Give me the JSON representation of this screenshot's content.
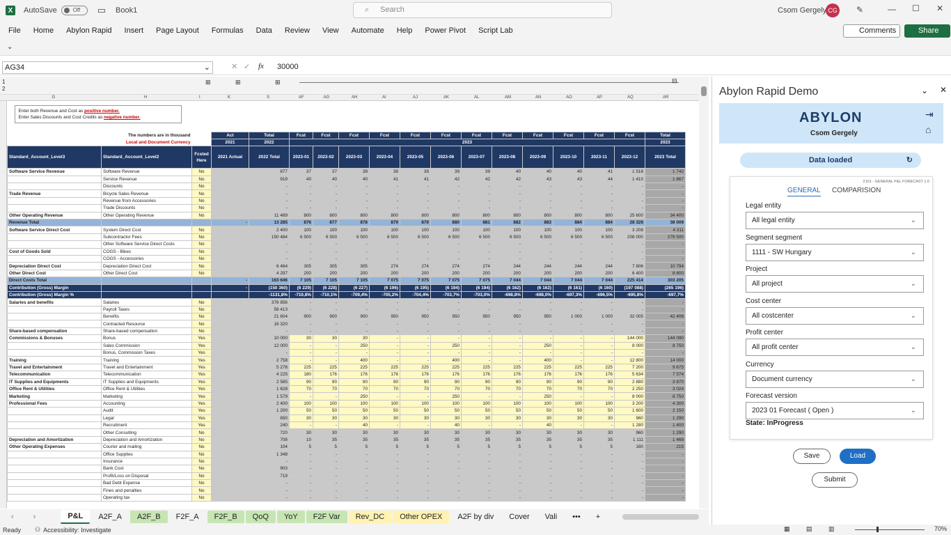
{
  "title_bar": {
    "autosave": "AutoSave",
    "toggle": "Off",
    "book": "Book1",
    "search": "Search",
    "user": "Csom Gergely",
    "initials": "CG"
  },
  "menu": [
    "File",
    "Home",
    "Abylon Rapid",
    "Insert",
    "Page Layout",
    "Formulas",
    "Data",
    "Review",
    "View",
    "Automate",
    "Help",
    "Power Pivot",
    "Script Lab"
  ],
  "comments": "Comments",
  "share": "Share",
  "formula": {
    "cell": "AG34",
    "value": "30000",
    "fx": "fx"
  },
  "columns": [
    "G",
    "H",
    "I",
    "K",
    "S",
    "AF",
    "AG",
    "AH",
    "AI",
    "AJ",
    "AK",
    "AL",
    "AM",
    "AN",
    "AO",
    "AP",
    "AQ",
    "AR",
    "AS"
  ],
  "note": {
    "l1a": "Enter both Revenue and Cost as ",
    "l1b": "positive number.",
    "l2a": "Enter Sales Discounts and  Cost Credits as ",
    "l2b": "negative number."
  },
  "thousand": "The numbers are in thousand",
  "currency_note": "Local and Document Currency",
  "hdr1": [
    "Act",
    "Total",
    "Fcst",
    "Fcst",
    "Fcst",
    "Fcst",
    "Fcst",
    "Fcst",
    "Fcst",
    "Fcst",
    "Fcst",
    "Fcst",
    "Fcst",
    "Fcst",
    "Total"
  ],
  "hdr2": {
    "y2021": "2021",
    "y2022": "2022",
    "y2023": "2023",
    "t2023": "2023"
  },
  "hdr3": {
    "l3": "Standard_Account_Level3",
    "l2": "Standard_Account_Level2",
    "fh": "Fcsted Here",
    "cols": [
      "2021 Actual",
      "2022 Total",
      "2023-01",
      "2023-02",
      "2023-03",
      "2023-04",
      "2023-05",
      "2023-06",
      "2023-07",
      "2023-08",
      "2023-09",
      "2023-10",
      "2023-11",
      "2023-12",
      "2023 Total"
    ]
  },
  "rows": [
    [
      "11",
      "Software Service Revenue",
      "Software Revenue",
      "No",
      "",
      "877",
      "37",
      "37",
      "38",
      "38",
      "38",
      "39",
      "39",
      "40",
      "40",
      "40",
      "41",
      "1 516",
      "1 742"
    ],
    [
      "12",
      "",
      "Service Revenue",
      "No",
      "",
      "919",
      "40",
      "40",
      "40",
      "41",
      "41",
      "42",
      "42",
      "42",
      "43",
      "43",
      "44",
      "1 410",
      "1 867"
    ],
    [
      "13",
      "",
      "Discounts",
      "No",
      "",
      "-",
      "-",
      "-",
      "-",
      "-",
      "-",
      "-",
      "-",
      "-",
      "-",
      "-",
      "-",
      "-",
      "-"
    ],
    [
      "14",
      "Trade Revenue",
      "Bicycle Sales Revenue",
      "No",
      "",
      "-",
      "-",
      "-",
      "-",
      "-",
      "-",
      "-",
      "-",
      "-",
      "-",
      "-",
      "-",
      "-",
      "-"
    ],
    [
      "15",
      "",
      "Revenue from Accessories",
      "No",
      "",
      "-",
      "-",
      "-",
      "-",
      "-",
      "-",
      "-",
      "-",
      "-",
      "-",
      "-",
      "-",
      "-",
      "-"
    ],
    [
      "16",
      "",
      "Trade Discounts",
      "No",
      "",
      "-",
      "-",
      "-",
      "-",
      "-",
      "-",
      "-",
      "-",
      "-",
      "-",
      "-",
      "-",
      "-",
      "-"
    ],
    [
      "17",
      "Other Operating Revenue",
      "Other Operating Revenue",
      "No",
      "",
      "11 489",
      "800",
      "800",
      "800",
      "800",
      "800",
      "800",
      "800",
      "800",
      "800",
      "800",
      "800",
      "25 600",
      "34 400"
    ],
    [
      "18",
      "Revenue Total",
      "",
      "",
      "-",
      "13 285",
      "876",
      "877",
      "878",
      "879",
      "879",
      "880",
      "881",
      "882",
      "883",
      "884",
      "884",
      "28 326",
      "38 009"
    ],
    [
      "19",
      "Software Service Direct Cost",
      "System Direct Cost",
      "No",
      "",
      "2 400",
      "100",
      "100",
      "100",
      "100",
      "100",
      "100",
      "100",
      "100",
      "100",
      "100",
      "100",
      "3 208",
      "4 311"
    ],
    [
      "20",
      "",
      "Subcontractor Fees",
      "No",
      "",
      "150 484",
      "6 500",
      "6 500",
      "6 500",
      "6 500",
      "6 500",
      "6 500",
      "6 500",
      "6 500",
      "6 500",
      "6 500",
      "6 500",
      "208 000",
      "279 500"
    ],
    [
      "21",
      "",
      "Other Software Service Direct Costs",
      "No",
      "",
      "-",
      "-",
      "-",
      "-",
      "-",
      "-",
      "-",
      "-",
      "-",
      "-",
      "-",
      "-",
      "-",
      "-"
    ],
    [
      "22",
      "Cost of Goods Sold",
      "COGS - Bikes",
      "No",
      "",
      "-",
      "-",
      "-",
      "-",
      "-",
      "-",
      "-",
      "-",
      "-",
      "-",
      "-",
      "-",
      "-",
      "-"
    ],
    [
      "23",
      "",
      "COGS - Accessories",
      "No",
      "",
      "-",
      "-",
      "-",
      "-",
      "-",
      "-",
      "-",
      "-",
      "-",
      "-",
      "-",
      "-",
      "-",
      "-"
    ],
    [
      "24",
      "Depreciation Direct Cost",
      "Depreciation Direct Cost",
      "No",
      "",
      "6 464",
      "305",
      "305",
      "305",
      "274",
      "274",
      "274",
      "274",
      "244",
      "244",
      "244",
      "244",
      "7 806",
      "10 794"
    ],
    [
      "25",
      "Other Direct Cost",
      "Other Direct Cost",
      "No",
      "",
      "4 297",
      "200",
      "200",
      "200",
      "200",
      "200",
      "200",
      "200",
      "200",
      "200",
      "200",
      "200",
      "6 400",
      "8 600"
    ],
    [
      "26",
      "Direct Costs Total",
      "",
      "",
      "-",
      "163 646",
      "7 105",
      "7 105",
      "7 105",
      "7 075",
      "7 075",
      "7 075",
      "7 075",
      "7 044",
      "7 044",
      "7 044",
      "7 044",
      "225 414",
      "303 205"
    ],
    [
      "27",
      "Contribution (Gross) Margin",
      "",
      "",
      "-",
      "(150 360)",
      "(6 229)",
      "(6 228)",
      "(6 227)",
      "(6 196)",
      "(6 195)",
      "(6 194)",
      "(6 194)",
      "(6 162)",
      "(6 162)",
      "(6 161)",
      "(6 160)",
      "(197 088)",
      "(265 196)"
    ],
    [
      "28",
      "Contribution (Gross) Margin %",
      "",
      "",
      "",
      "-1131,8%",
      "-710,8%",
      "-710,1%",
      "-709,4%",
      "-705,2%",
      "-704,4%",
      "-703,7%",
      "-703,0%",
      "-698,8%",
      "-698,0%",
      "-697,3%",
      "-696,5%",
      "-695,8%",
      "-697,7%"
    ],
    [
      "29",
      "Salaries and benefits",
      "Salaries",
      "No",
      "",
      "376 856",
      "-",
      "-",
      "-",
      "-",
      "-",
      "-",
      "-",
      "-",
      "-",
      "-",
      "-",
      "-",
      "-"
    ],
    [
      "30",
      "",
      "Payroll Taxes",
      "No",
      "",
      "58 413",
      "-",
      "-",
      "-",
      "-",
      "-",
      "-",
      "-",
      "-",
      "-",
      "-",
      "-",
      "-",
      "-"
    ],
    [
      "31",
      "",
      "Benefits",
      "No",
      "",
      "21 604",
      "900",
      "900",
      "900",
      "950",
      "950",
      "950",
      "950",
      "950",
      "950",
      "1 000",
      "1 000",
      "32 005",
      "42 406"
    ],
    [
      "32",
      "",
      "Contracted Resource",
      "No",
      "",
      "16 320",
      "-",
      "-",
      "-",
      "-",
      "-",
      "-",
      "-",
      "-",
      "-",
      "-",
      "-",
      "-",
      "-"
    ],
    [
      "33",
      "Share-based compensation",
      "Share-based compensation",
      "No",
      "",
      "-",
      "-",
      "-",
      "-",
      "-",
      "-",
      "-",
      "-",
      "-",
      "-",
      "-",
      "-",
      "-",
      "-"
    ],
    [
      "34",
      "Commissions & Bonuses",
      "Bonus",
      "Yes",
      "",
      "10 000",
      "30",
      "30",
      "30",
      "-",
      "-",
      "-",
      "-",
      "-",
      "-",
      "-",
      "-",
      "144 000",
      "144 090"
    ],
    [
      "35",
      "",
      "Sales Commission",
      "Yes",
      "",
      "12 000",
      "-",
      "-",
      "250",
      "-",
      "-",
      "250",
      "-",
      "-",
      "250",
      "-",
      "-",
      "8 000",
      "8 750"
    ],
    [
      "36",
      "",
      "Bonus, Commission Taxes",
      "Yes",
      "",
      "-",
      "-",
      "-",
      "-",
      "-",
      "-",
      "-",
      "-",
      "-",
      "-",
      "-",
      "-",
      "-",
      "-"
    ],
    [
      "37",
      "Training",
      "Training",
      "Yes",
      "",
      "2 758",
      "-",
      "-",
      "400",
      "-",
      "-",
      "400",
      "-",
      "-",
      "400",
      "-",
      "-",
      "12 800",
      "14 000"
    ],
    [
      "38",
      "Travel and Entertainment",
      "Travel and Entertainment",
      "Yes",
      "",
      "5 276",
      "225",
      "225",
      "225",
      "225",
      "225",
      "225",
      "225",
      "225",
      "225",
      "225",
      "225",
      "7 200",
      "9 675"
    ],
    [
      "39",
      "Telecommunication",
      "Telecommunication",
      "Yes",
      "",
      "4 225",
      "180",
      "176",
      "176",
      "176",
      "176",
      "176",
      "176",
      "176",
      "176",
      "176",
      "176",
      "5 634",
      "7 574"
    ],
    [
      "40",
      "IT Supplies and Equipments",
      "IT Supplies and Equipments",
      "Yes",
      "",
      "2 585",
      "90",
      "90",
      "90",
      "90",
      "90",
      "90",
      "90",
      "90",
      "90",
      "90",
      "90",
      "2 880",
      "3 870"
    ],
    [
      "41",
      "Office Rent & Utilities",
      "Office Rent & Utilities",
      "Yes",
      "",
      "1 628",
      "70",
      "70",
      "70",
      "70",
      "70",
      "70",
      "70",
      "70",
      "70",
      "70",
      "70",
      "2 250",
      "3 024"
    ],
    [
      "42",
      "Marketing",
      "Marketing",
      "Yes",
      "",
      "1 579",
      "-",
      "-",
      "250",
      "-",
      "-",
      "250",
      "-",
      "-",
      "250",
      "-",
      "-",
      "8 000",
      "8 750"
    ],
    [
      "43",
      "Professional Fees",
      "Accounting",
      "Yes",
      "",
      "2 400",
      "100",
      "100",
      "100",
      "100",
      "100",
      "100",
      "100",
      "100",
      "100",
      "100",
      "100",
      "3 200",
      "4 300"
    ],
    [
      "44",
      "",
      "Audit",
      "Yes",
      "",
      "1 200",
      "50",
      "50",
      "50",
      "50",
      "50",
      "50",
      "50",
      "50",
      "50",
      "50",
      "50",
      "1 600",
      "2 150"
    ],
    [
      "45",
      "",
      "Legal",
      "Yes",
      "",
      "650",
      "30",
      "30",
      "30",
      "30",
      "30",
      "30",
      "30",
      "30",
      "30",
      "30",
      "30",
      "960",
      "1 290"
    ],
    [
      "46",
      "",
      "Recruitment",
      "Yes",
      "",
      "240",
      "-",
      "-",
      "40",
      "-",
      "-",
      "40",
      "-",
      "-",
      "40",
      "-",
      "-",
      "1 280",
      "1 400"
    ],
    [
      "47",
      "",
      "Other Consulting",
      "No",
      "",
      "720",
      "30",
      "30",
      "30",
      "30",
      "30",
      "30",
      "30",
      "30",
      "30",
      "30",
      "30",
      "960",
      "1 290"
    ],
    [
      "48",
      "Depreciation and Amortization",
      "Depreciation and Amortization",
      "No",
      "",
      "708",
      "10",
      "35",
      "35",
      "35",
      "35",
      "35",
      "35",
      "35",
      "35",
      "35",
      "35",
      "1 111",
      "1 468"
    ],
    [
      "49",
      "Other Operating Expenses",
      "Courier and mailing",
      "No",
      "",
      "104",
      "5",
      "5",
      "5",
      "5",
      "5",
      "5",
      "5",
      "5",
      "5",
      "5",
      "5",
      "160",
      "215"
    ],
    [
      "50",
      "",
      "Office Supplies",
      "No",
      "",
      "1 348",
      "-",
      "-",
      "-",
      "-",
      "-",
      "-",
      "-",
      "-",
      "-",
      "-",
      "-",
      "-",
      "-"
    ],
    [
      "51",
      "",
      "Insurance",
      "No",
      "",
      "-",
      "-",
      "-",
      "-",
      "-",
      "-",
      "-",
      "-",
      "-",
      "-",
      "-",
      "-",
      "-",
      "-"
    ],
    [
      "52",
      "",
      "Bank Cost",
      "No",
      "",
      "903",
      "-",
      "-",
      "-",
      "-",
      "-",
      "-",
      "-",
      "-",
      "-",
      "-",
      "-",
      "-",
      "-"
    ],
    [
      "53",
      "",
      "Profit/Loss on Disposal",
      "No",
      "",
      "719",
      "-",
      "-",
      "-",
      "-",
      "-",
      "-",
      "-",
      "-",
      "-",
      "-",
      "-",
      "-",
      "-"
    ],
    [
      "54",
      "",
      "Bad Debt Expense",
      "No",
      "",
      "-",
      "-",
      "-",
      "-",
      "-",
      "-",
      "-",
      "-",
      "-",
      "-",
      "-",
      "-",
      "-",
      "-"
    ],
    [
      "55",
      "",
      "Fines and penalties",
      "No",
      "",
      "-",
      "-",
      "-",
      "-",
      "-",
      "-",
      "-",
      "-",
      "-",
      "-",
      "-",
      "-",
      "-",
      "-"
    ],
    [
      "56",
      "",
      "Operating tax",
      "No",
      "",
      "-",
      "-",
      "-",
      "-",
      "-",
      "-",
      "-",
      "-",
      "-",
      "-",
      "-",
      "-",
      "-",
      "-"
    ]
  ],
  "tabs": [
    "P&L",
    "A2F_A",
    "A2F_B",
    "F2F_A",
    "F2F_B",
    "QoQ",
    "YoY",
    "F2F Var",
    "Rev_DC",
    "Other OPEX",
    "A2F by div",
    "Cover",
    "Vali",
    "•••",
    "+"
  ],
  "status": {
    "ready": "Ready",
    "access": "Accessibility: Investigate",
    "zoom": "70%"
  },
  "pane": {
    "title": "Abylon Rapid Demo",
    "logo": "ABYLON",
    "user": "Csom Gergely",
    "data_loaded": "Data loaded",
    "version": "2101 - GENERAL P&L FORECAST 1.0",
    "tab_general": "GENERAL",
    "tab_comp": "COMPARISION",
    "fields": [
      {
        "label": "Legal entity",
        "value": "All legal entity"
      },
      {
        "label": "Segment segment",
        "value": "1111 - SW Hungary"
      },
      {
        "label": "Project",
        "value": "All project"
      },
      {
        "label": "Cost center",
        "value": "All costcenter"
      },
      {
        "label": "Profit center",
        "value": "All profit center"
      },
      {
        "label": "Currency",
        "value": "Document currency"
      },
      {
        "label": "Forecast version",
        "value": "2023 01 Forecast ( Open )"
      }
    ],
    "state": "State: InProgress",
    "save": "Save",
    "load": "Load",
    "submit": "Submit"
  }
}
